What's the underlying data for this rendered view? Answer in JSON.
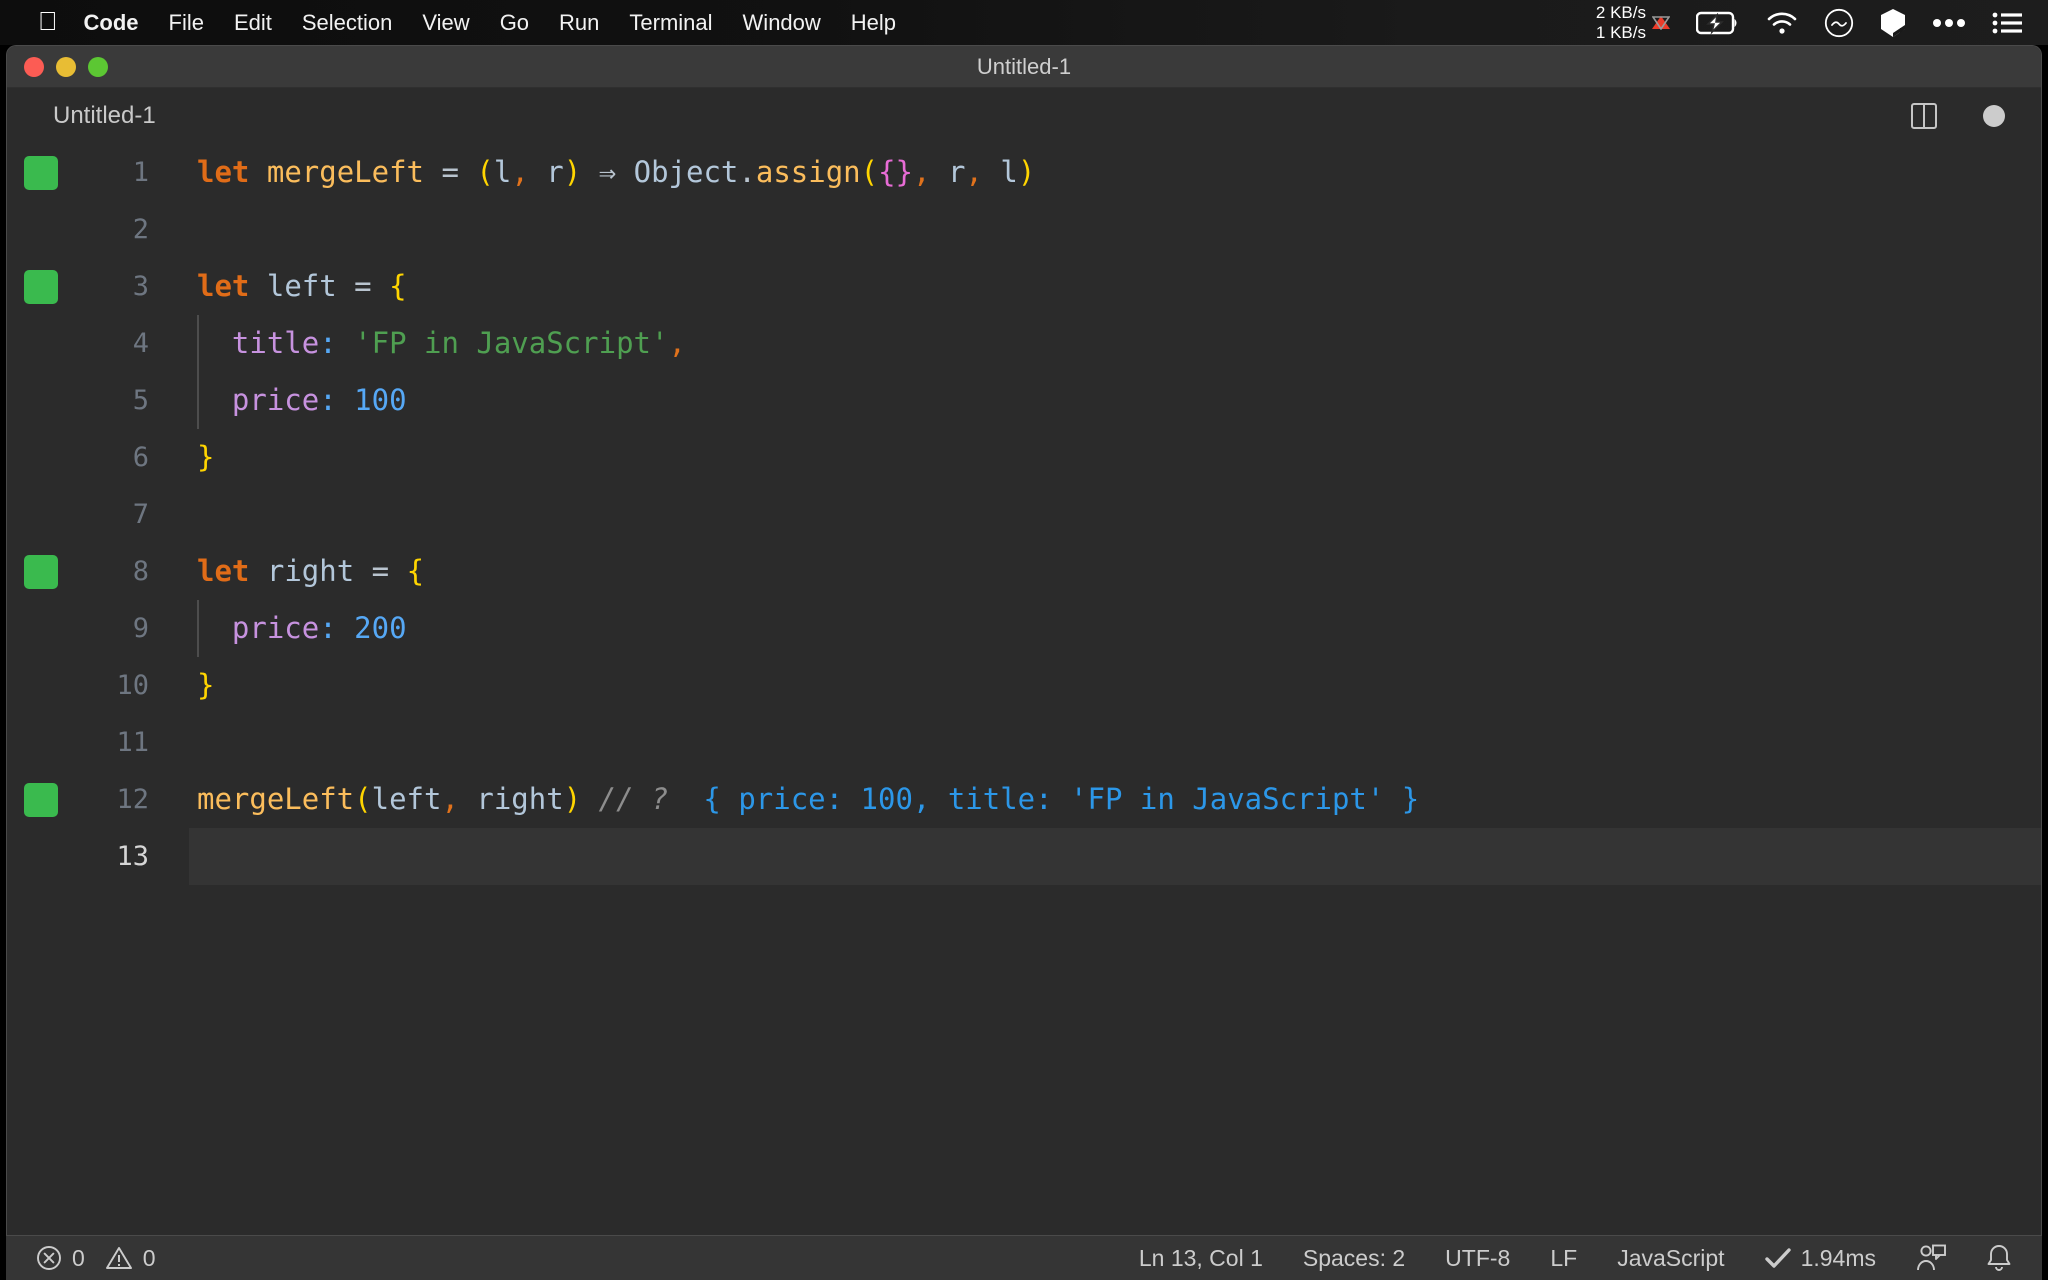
{
  "menubar": {
    "apple_icon": "apple-logo-icon",
    "items": [
      {
        "label": "Code",
        "bold": true
      },
      {
        "label": "File",
        "bold": false
      },
      {
        "label": "Edit",
        "bold": false
      },
      {
        "label": "Selection",
        "bold": false
      },
      {
        "label": "View",
        "bold": false
      },
      {
        "label": "Go",
        "bold": false
      },
      {
        "label": "Run",
        "bold": false
      },
      {
        "label": "Terminal",
        "bold": false
      },
      {
        "label": "Window",
        "bold": false
      },
      {
        "label": "Help",
        "bold": false
      }
    ],
    "tray": {
      "network_up": "2 KB/s",
      "network_down": "1 KB/s",
      "battery_icon": "battery-charging-icon",
      "wifi_icon": "wifi-icon",
      "mood_icon": "frown-circle-icon",
      "dropbox_icon": "cube-icon",
      "more_icon": "ellipsis-icon",
      "control_center_icon": "list-icon"
    }
  },
  "window": {
    "title": "Untitled-1",
    "traffic_lights": [
      "close-button",
      "minimize-button",
      "zoom-button"
    ]
  },
  "tab": {
    "name": "Untitled-1",
    "split_editor_icon": "split-editor-icon",
    "dirty_indicator": "unsaved-dot-icon"
  },
  "editor": {
    "lines": [
      {
        "number": "1",
        "git": true,
        "indent_guide": false,
        "active": false,
        "tokens": [
          {
            "t": "let",
            "c": "kw"
          },
          {
            "t": " ",
            "c": "op"
          },
          {
            "t": "mergeLeft",
            "c": "fn"
          },
          {
            "t": " ",
            "c": "op"
          },
          {
            "t": "=",
            "c": "op"
          },
          {
            "t": " ",
            "c": "op"
          },
          {
            "t": "(",
            "c": "paren"
          },
          {
            "t": "l",
            "c": "var"
          },
          {
            "t": ",",
            "c": "comma"
          },
          {
            "t": " ",
            "c": "op"
          },
          {
            "t": "r",
            "c": "var"
          },
          {
            "t": ")",
            "c": "paren"
          },
          {
            "t": " ",
            "c": "op"
          },
          {
            "t": "⇒",
            "c": "op"
          },
          {
            "t": " ",
            "c": "op"
          },
          {
            "t": "Object",
            "c": "var"
          },
          {
            "t": ".",
            "c": "op"
          },
          {
            "t": "assign",
            "c": "fn"
          },
          {
            "t": "(",
            "c": "paren"
          },
          {
            "t": "{}",
            "c": "brace2"
          },
          {
            "t": ",",
            "c": "comma"
          },
          {
            "t": " ",
            "c": "op"
          },
          {
            "t": "r",
            "c": "var"
          },
          {
            "t": ",",
            "c": "comma"
          },
          {
            "t": " ",
            "c": "op"
          },
          {
            "t": "l",
            "c": "var"
          },
          {
            "t": ")",
            "c": "paren"
          }
        ]
      },
      {
        "number": "2",
        "git": false,
        "indent_guide": false,
        "active": false,
        "tokens": []
      },
      {
        "number": "3",
        "git": true,
        "indent_guide": false,
        "active": false,
        "tokens": [
          {
            "t": "let",
            "c": "kw"
          },
          {
            "t": " ",
            "c": "op"
          },
          {
            "t": "left",
            "c": "var"
          },
          {
            "t": " ",
            "c": "op"
          },
          {
            "t": "=",
            "c": "op"
          },
          {
            "t": " ",
            "c": "op"
          },
          {
            "t": "{",
            "c": "brace"
          }
        ]
      },
      {
        "number": "4",
        "git": false,
        "indent_guide": true,
        "active": false,
        "tokens": [
          {
            "t": "  ",
            "c": "op"
          },
          {
            "t": "title",
            "c": "prop"
          },
          {
            "t": ":",
            "c": "colon"
          },
          {
            "t": " ",
            "c": "op"
          },
          {
            "t": "'FP in JavaScript'",
            "c": "str"
          },
          {
            "t": ",",
            "c": "comma"
          }
        ]
      },
      {
        "number": "5",
        "git": false,
        "indent_guide": true,
        "active": false,
        "tokens": [
          {
            "t": "  ",
            "c": "op"
          },
          {
            "t": "price",
            "c": "prop"
          },
          {
            "t": ":",
            "c": "colon"
          },
          {
            "t": " ",
            "c": "op"
          },
          {
            "t": "100",
            "c": "num"
          }
        ]
      },
      {
        "number": "6",
        "git": false,
        "indent_guide": false,
        "active": false,
        "tokens": [
          {
            "t": "}",
            "c": "brace"
          }
        ]
      },
      {
        "number": "7",
        "git": false,
        "indent_guide": false,
        "active": false,
        "tokens": []
      },
      {
        "number": "8",
        "git": true,
        "indent_guide": false,
        "active": false,
        "tokens": [
          {
            "t": "let",
            "c": "kw"
          },
          {
            "t": " ",
            "c": "op"
          },
          {
            "t": "right",
            "c": "var"
          },
          {
            "t": " ",
            "c": "op"
          },
          {
            "t": "=",
            "c": "op"
          },
          {
            "t": " ",
            "c": "op"
          },
          {
            "t": "{",
            "c": "brace"
          }
        ]
      },
      {
        "number": "9",
        "git": false,
        "indent_guide": true,
        "active": false,
        "tokens": [
          {
            "t": "  ",
            "c": "op"
          },
          {
            "t": "price",
            "c": "prop"
          },
          {
            "t": ":",
            "c": "colon"
          },
          {
            "t": " ",
            "c": "op"
          },
          {
            "t": "200",
            "c": "num"
          }
        ]
      },
      {
        "number": "10",
        "git": false,
        "indent_guide": false,
        "active": false,
        "tokens": [
          {
            "t": "}",
            "c": "brace"
          }
        ]
      },
      {
        "number": "11",
        "git": false,
        "indent_guide": false,
        "active": false,
        "tokens": []
      },
      {
        "number": "12",
        "git": true,
        "indent_guide": false,
        "active": false,
        "tokens": [
          {
            "t": "mergeLeft",
            "c": "fn"
          },
          {
            "t": "(",
            "c": "paren"
          },
          {
            "t": "left",
            "c": "var"
          },
          {
            "t": ",",
            "c": "comma"
          },
          {
            "t": " ",
            "c": "op"
          },
          {
            "t": "right",
            "c": "var"
          },
          {
            "t": ")",
            "c": "paren"
          },
          {
            "t": " ",
            "c": "op"
          },
          {
            "t": "// ?",
            "c": "cmt"
          },
          {
            "t": "  ",
            "c": "op"
          },
          {
            "t": "{ price: 100, title: 'FP in JavaScript' }",
            "c": "res"
          }
        ]
      },
      {
        "number": "13",
        "git": false,
        "indent_guide": false,
        "active": true,
        "tokens": []
      }
    ]
  },
  "statusbar": {
    "error_icon": "error-circle-icon",
    "error_count": "0",
    "warning_icon": "warning-triangle-icon",
    "warning_count": "0",
    "cursor_position": "Ln 13, Col 1",
    "indentation": "Spaces: 2",
    "encoding": "UTF-8",
    "eol": "LF",
    "language": "JavaScript",
    "run_check_icon": "checkmark-icon",
    "run_time": "1.94ms",
    "live_share_icon": "live-share-icon",
    "bell_icon": "bell-icon"
  },
  "colors": {
    "editor_background": "#2b2b2b",
    "active_line": "#343434",
    "titlebar": "#3a3a3a",
    "statusbar": "#353535",
    "git_added": "#3aba4e",
    "keyword": "#e06c18",
    "function": "#fbbd5c",
    "string": "#4f9f51",
    "number": "#56a8f5",
    "property": "#c792df",
    "bracket_yellow": "#ffd500",
    "bracket_magenta": "#e86cd6",
    "comment": "#8d8d8d",
    "inline_result": "#2c97e8"
  }
}
